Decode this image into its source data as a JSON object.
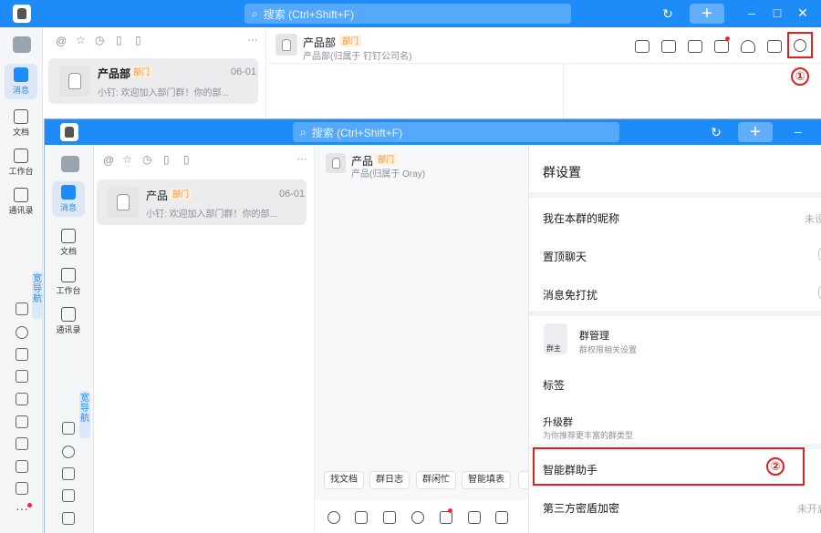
{
  "back_window": {
    "search_placeholder": "搜索 (Ctrl+Shift+F)",
    "rail": [
      "消息",
      "文档",
      "工作台",
      "通讯录"
    ],
    "wide_nav": "宽导航",
    "conversation": {
      "name": "产品部",
      "tag": "部门",
      "date": "06-01",
      "preview": "小钉: 欢迎加入部门群！你的部..."
    },
    "chat_title": "产品部",
    "chat_tag": "部门",
    "chat_subtitle": "产品部(归属于 钉钉公司名)",
    "marker_1": "①"
  },
  "front_window": {
    "search_placeholder": "搜索 (Ctrl+Shift+F)",
    "rail": [
      "消息",
      "文档",
      "工作台",
      "通讯录"
    ],
    "wide_nav": "宽导航",
    "conversation": {
      "name": "产品",
      "tag": "部门",
      "date": "06-01",
      "preview": "小钉: 欢迎加入部门群！你的部..."
    },
    "chat_title": "产品",
    "chat_tag": "部门",
    "chat_subtitle": "产品(归属于 Oray)",
    "quick_chips": [
      "找文档",
      "群日志",
      "群闲忙",
      "智能填表"
    ],
    "settings": {
      "title": "群设置",
      "nickname_label": "我在本群的昵称",
      "nickname_value": "未设",
      "pin_label": "置顶聊天",
      "mute_label": "消息免打扰",
      "manage_label": "群管理",
      "manage_sub": "群权限相关设置",
      "owner_badge": "群主",
      "tags_label": "标签",
      "upgrade_label": "升级群",
      "upgrade_sub": "为你推荐更丰富的群类型",
      "assistant_label": "智能群助手",
      "encrypt_label": "第三方密盾加密",
      "encrypt_value": "未开启"
    },
    "marker_2": "②"
  },
  "colors": {
    "brand": "#1d8cf8",
    "tag": "#ff8a1f",
    "highlight": "#e0201c"
  }
}
